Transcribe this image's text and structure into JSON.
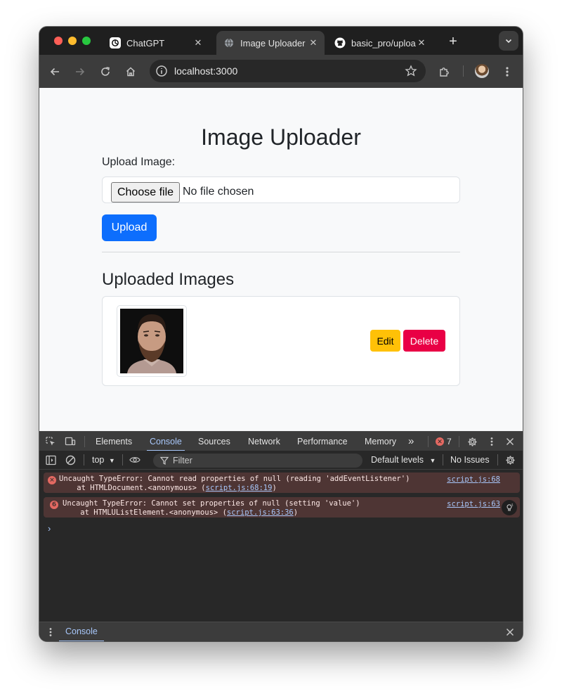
{
  "browser": {
    "tabs": [
      {
        "title": "ChatGPT",
        "icon": "chatgpt-icon"
      },
      {
        "title": "Image Uploader",
        "icon": "globe-icon",
        "active": true
      },
      {
        "title": "basic_pro/uploa",
        "icon": "github-icon"
      }
    ],
    "url": "localhost:3000"
  },
  "page": {
    "title": "Image Uploader",
    "upload_label": "Upload Image:",
    "choose_file_label": "Choose file",
    "no_file_text": "No file chosen",
    "upload_button": "Upload",
    "uploaded_heading": "Uploaded Images",
    "edit_button": "Edit",
    "delete_button": "Delete"
  },
  "devtools": {
    "tabs": [
      "Elements",
      "Console",
      "Sources",
      "Network",
      "Performance",
      "Memory"
    ],
    "active_tab": "Console",
    "overflow": "»",
    "error_count": "7",
    "context": "top",
    "filter_placeholder": "Filter",
    "levels": "Default levels",
    "issues": "No Issues",
    "messages": [
      {
        "line1": "Uncaught TypeError: Cannot read properties of null (reading 'addEventListener')",
        "line2_prefix": "    at HTMLDocument.<anonymous> (",
        "line2_link": "script.js:68:19",
        "line2_suffix": ")",
        "source": "script.js:68",
        "badge": "×"
      },
      {
        "line1": "Uncaught TypeError: Cannot set properties of null (setting 'value')",
        "line2_prefix": "    at HTMLUListElement.<anonymous> (",
        "line2_link": "script.js:63:36",
        "line2_suffix": ")",
        "source": "script.js:63",
        "badge": "6"
      }
    ],
    "prompt": "›",
    "drawer_tab": "Console"
  },
  "colors": {
    "primary": "#0d6efd",
    "warning": "#ffc107",
    "danger": "#e90045",
    "devtools_accent": "#a8c7fa"
  }
}
